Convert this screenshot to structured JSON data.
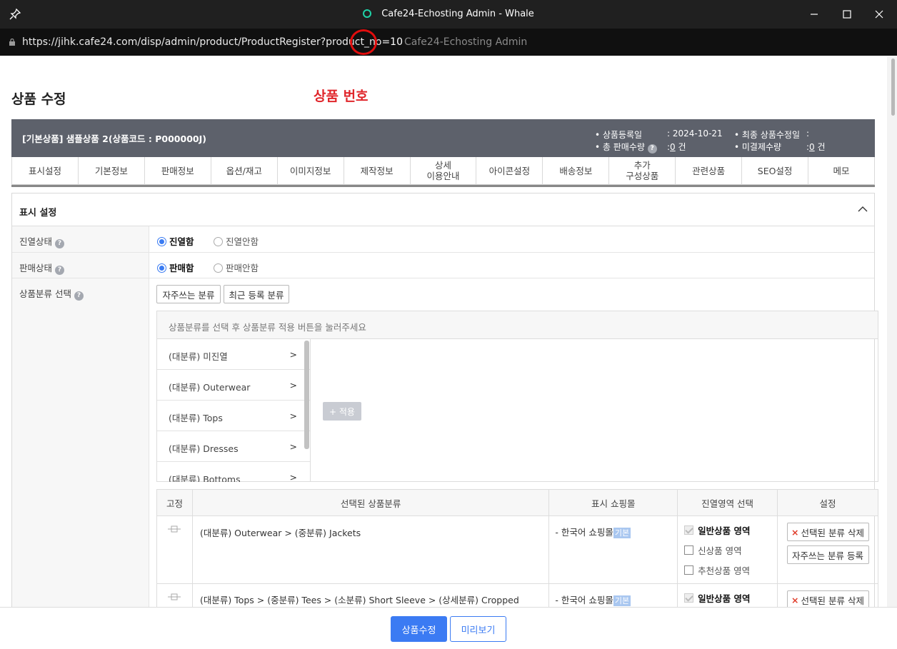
{
  "window": {
    "title": "Cafe24-Echosting Admin - Whale",
    "pin_icon": "pin-icon",
    "minimize_icon": "minimize-icon",
    "maximize_icon": "maximize-icon",
    "close_icon": "close-icon"
  },
  "address": {
    "url_main": "https://jihk.cafe24.com/disp/admin/product/ProductRegister?product_no",
    "url_param": "=10",
    "page_title_faded": "Cafe24-Echosting Admin",
    "lock_icon": "lock-icon"
  },
  "page": {
    "title": "상품 수정",
    "annotation": "상품 번호"
  },
  "product_bar": {
    "name": "[기본상품] 샘플상품 2(상품코드 : P000000J)",
    "reg_date_label": "• 상품등록일",
    "reg_date_value": ": 2024-10-21",
    "total_sales_label": "• 총 판매수량",
    "total_sales_value": "0",
    "total_sales_unit": "건",
    "last_modified_label": "• 최종 상품수정일",
    "last_modified_value": ":",
    "unpaid_label": "• 미결제수량",
    "unpaid_value": "0",
    "unpaid_unit": "건"
  },
  "tabs": [
    {
      "line1": "표시설정",
      "line2": ""
    },
    {
      "line1": "기본정보",
      "line2": ""
    },
    {
      "line1": "판매정보",
      "line2": ""
    },
    {
      "line1": "옵션/재고",
      "line2": ""
    },
    {
      "line1": "이미지정보",
      "line2": ""
    },
    {
      "line1": "제작정보",
      "line2": ""
    },
    {
      "line1": "상세",
      "line2": "이용안내"
    },
    {
      "line1": "아이콘설정",
      "line2": ""
    },
    {
      "line1": "배송정보",
      "line2": ""
    },
    {
      "line1": "추가",
      "line2": "구성상품"
    },
    {
      "line1": "관련상품",
      "line2": ""
    },
    {
      "line1": "SEO설정",
      "line2": ""
    },
    {
      "line1": "메모",
      "line2": ""
    }
  ],
  "display_section": {
    "title": "표시 설정",
    "display_status": {
      "label": "진열상태",
      "options": [
        "진열함",
        "진열안함"
      ],
      "selected": "진열함"
    },
    "sale_status": {
      "label": "판매상태",
      "options": [
        "판매함",
        "판매안함"
      ],
      "selected": "판매함"
    },
    "category": {
      "label": "상품분류 선택",
      "frequent_button": "자주쓰는 분류",
      "recent_button": "최근 등록 분류",
      "hint": "상품분류를 선택 후 상품분류 적용 버튼을 눌러주세요",
      "items": [
        {
          "label": "(대분류) 미진열",
          "arrow": ">"
        },
        {
          "label": "(대분류) Outerwear",
          "arrow": ">"
        },
        {
          "label": "(대분류) Tops",
          "arrow": ">"
        },
        {
          "label": "(대분류) Dresses",
          "arrow": ">"
        },
        {
          "label": "(대분류) Bottoms",
          "arrow": ">"
        }
      ],
      "apply_button": "+ 적용"
    },
    "selected_table": {
      "headers": [
        "고정",
        "선택된 상품분류",
        "표시 쇼핑몰",
        "진열영역 선택",
        "설정"
      ],
      "rows": [
        {
          "path": "(대분류) Outerwear > (중분류) Jackets",
          "mall": "- 한국어 쇼핑몰",
          "mall_badge": "기본",
          "areas": [
            "일반상품 영역",
            "신상품 영역",
            "추천상품 영역"
          ],
          "delete_button": "선택된 분류 삭제",
          "frequent_button": "자주쓰는 분류 등록"
        },
        {
          "path": "(대분류) Tops > (중분류) Tees > (소분류) Short Sleeve > (상세분류) Cropped",
          "mall": "- 한국어 쇼핑몰",
          "mall_badge": "기본",
          "areas": [
            "일반상품 영역"
          ],
          "delete_button": "선택된 분류 삭제"
        }
      ]
    }
  },
  "footer": {
    "save_button": "상품수정",
    "preview_button": "미리보기"
  },
  "colors": {
    "accent": "#3b7bf3",
    "annotation_red": "#e0262b",
    "product_bar": "#5d616b"
  }
}
